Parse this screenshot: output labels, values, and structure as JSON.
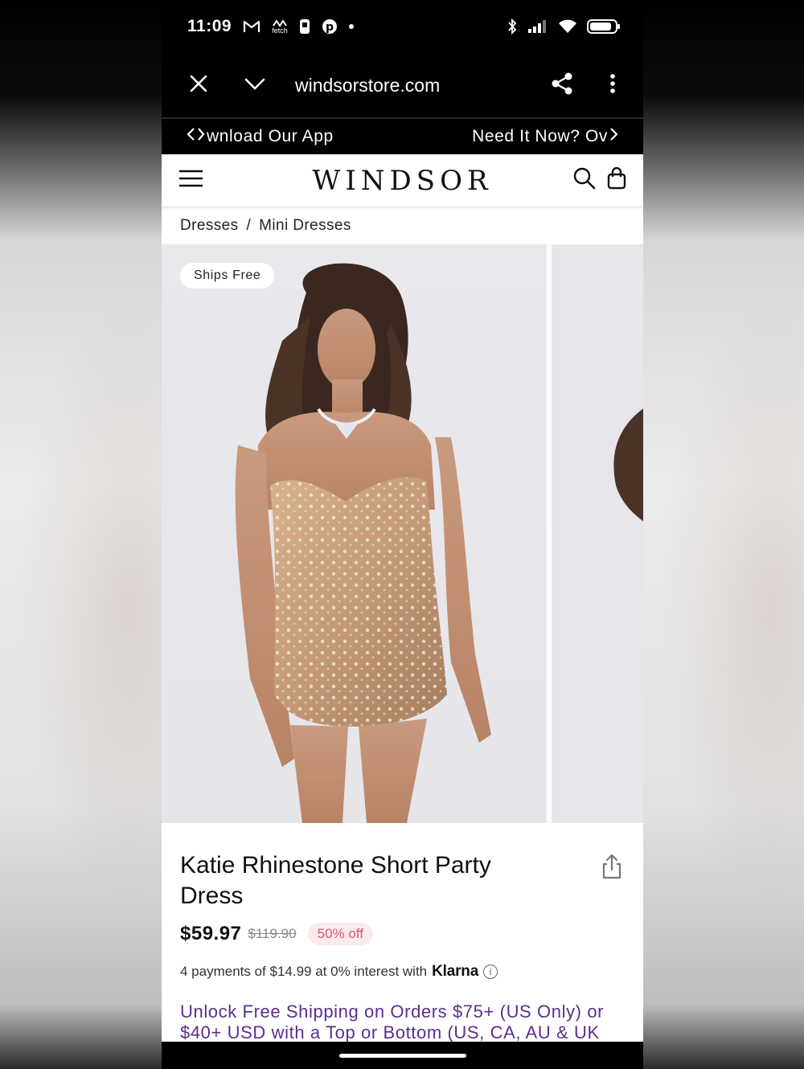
{
  "status_bar": {
    "time": "11:09",
    "left_icons": [
      "gmail-icon",
      "fetch-icon",
      "doordash-icon",
      "pinterest-icon",
      "dot-icon"
    ],
    "fetch_label": "fetch",
    "right_icons": [
      "bluetooth-icon",
      "signal-icon",
      "wifi-icon",
      "battery-icon"
    ]
  },
  "browser": {
    "url": "windsorstore.com",
    "close_icon": "close-icon",
    "collapse_icon": "chevron-down-icon",
    "share_icon": "share-icon",
    "menu_icon": "more-vert-icon"
  },
  "promo_bar": {
    "left_text": "wnload Our App",
    "right_text": "Need It Now? Ov"
  },
  "header": {
    "logo": "WINDSOR",
    "menu_icon": "hamburger-icon",
    "search_icon": "search-icon",
    "bag_icon": "bag-icon"
  },
  "breadcrumb": {
    "items": [
      "Dresses",
      "Mini Dresses"
    ],
    "separator": "/"
  },
  "gallery": {
    "badge": "Ships Free"
  },
  "product": {
    "title": "Katie Rhinestone Short Party Dress",
    "price": "$59.97",
    "original_price": "$119.90",
    "discount": "50% off",
    "installments_text": "4 payments of $14.99 at 0% interest with",
    "klarna": "Klarna",
    "shipping_promo": "Unlock Free Shipping on Orders $75+ (US Only) or $40+ USD with a Top or Bottom (US, CA, AU & UK"
  },
  "colors": {
    "promo_purple": "#5b2e8f",
    "discount_pink": "#d35a6d",
    "discount_bg": "#fbeaec"
  }
}
